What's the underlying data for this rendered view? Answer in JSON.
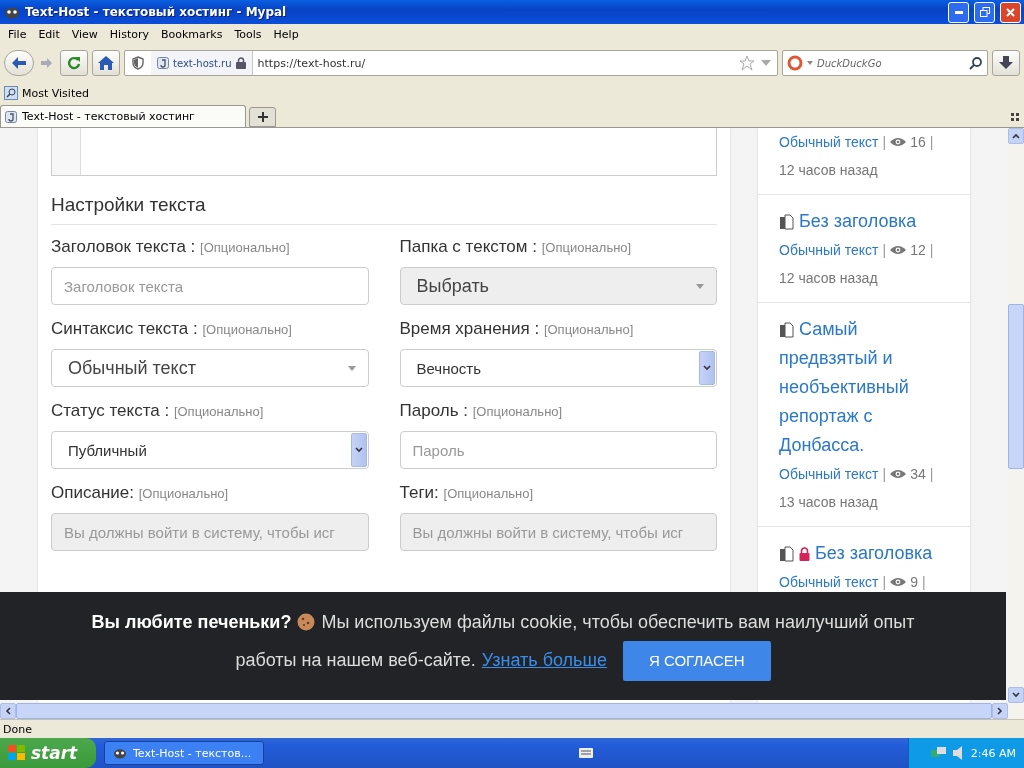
{
  "window": {
    "title": "Text-Host - текстовый хостинг - Mypal"
  },
  "menu": [
    "File",
    "Edit",
    "View",
    "History",
    "Bookmarks",
    "Tools",
    "Help"
  ],
  "navbar": {
    "site_identity": "text-host.ru",
    "url": "https://text-host.ru/",
    "search_placeholder": "DuckDuckGo"
  },
  "bookmarks": [
    "Most Visited"
  ],
  "tabs": [
    {
      "label": "Text-Host - текстовый хостинг",
      "selected": true
    }
  ],
  "settings": {
    "heading": "Настройки текста",
    "fields": [
      {
        "label": "Заголовок текста :",
        "hint": "[Опционально]",
        "kind": "text",
        "placeholder": "Заголовок текста",
        "disabled": false
      },
      {
        "label": "Папка с текстом :",
        "hint": "[Опционально]",
        "kind": "select",
        "value": "Выбрать",
        "disabled": true
      },
      {
        "label": "Синтаксис текста :",
        "hint": "[Опционально]",
        "kind": "select",
        "value": "Обычный текст",
        "disabled": false
      },
      {
        "label": "Время хранения :",
        "hint": "[Опционально]",
        "kind": "native",
        "value": "Вечность"
      },
      {
        "label": "Статус текста :",
        "hint": "[Опционально]",
        "kind": "native",
        "value": "Публичный"
      },
      {
        "label": "Пароль :",
        "hint": "[Опционально]",
        "kind": "text",
        "placeholder": "Пароль",
        "disabled": false
      },
      {
        "label": "Описание:",
        "hint": "[Опционально]",
        "kind": "text",
        "placeholder": "Вы должны войти в систему, чтобы исг",
        "disabled": true
      },
      {
        "label": "Теги:",
        "hint": "[Опционально]",
        "kind": "text",
        "placeholder": "Вы должны войти в систему, чтобы исг",
        "disabled": true
      }
    ]
  },
  "sidebar": {
    "separator": "|",
    "items": [
      {
        "type": "Обычный текст",
        "views": "16",
        "time": "12 часов назад"
      },
      {
        "title": "Без заголовка",
        "locked": false,
        "type": "Обычный текст",
        "views": "12",
        "time": "12 часов назад"
      },
      {
        "title": "Самый предвзятый и необъективный репортаж с Донбасса.",
        "locked": false,
        "type": "Обычный текст",
        "views": "34",
        "time": "13 часов назад"
      },
      {
        "title": "Без заголовка",
        "locked": true,
        "type": "Обычный текст",
        "views": "9"
      }
    ]
  },
  "cookie_banner": {
    "lead": "Вы любите печеньки?",
    "message_lines": [
      "Мы используем файлы cookie, чтобы обеспечить вам наилучший опыт",
      "работы на нашем веб-сайте."
    ],
    "link": "Узнать больше",
    "button": "Я СОГЛАСЕН"
  },
  "status_bar": "Done",
  "taskbar": {
    "start": "start",
    "tasks": [
      "Text-Host - текстов..."
    ],
    "clock": "2:46 AM"
  }
}
